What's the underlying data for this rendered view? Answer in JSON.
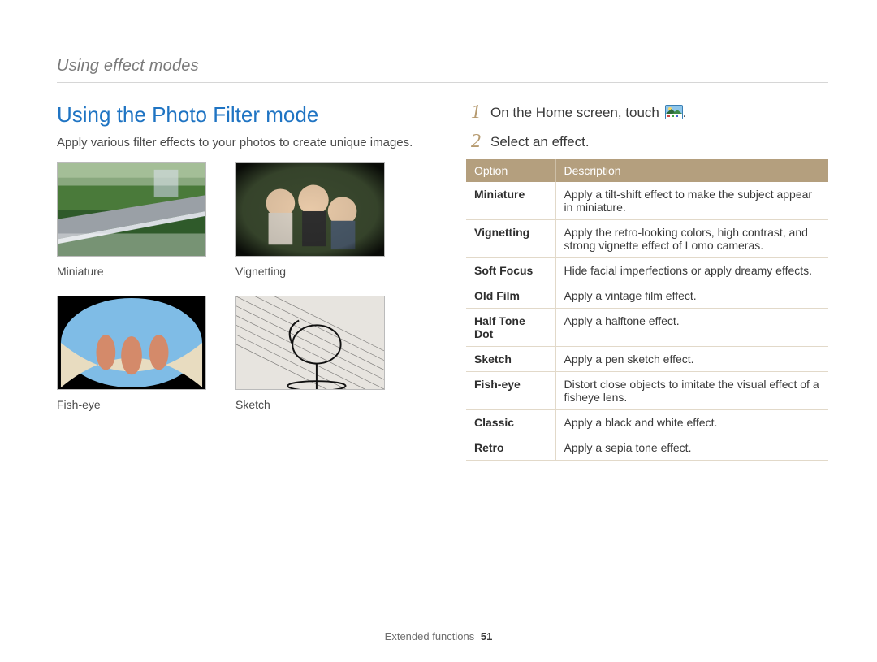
{
  "breadcrumb": "Using effect modes",
  "section_title": "Using the Photo Filter mode",
  "lead": "Apply various filter effects to your photos to create unique images.",
  "thumbs": {
    "miniature": "Miniature",
    "vignetting": "Vignetting",
    "fisheye": "Fish-eye",
    "sketch": "Sketch"
  },
  "steps": {
    "s1_num": "1",
    "s1_text_prefix": "On the Home screen, touch ",
    "s1_text_suffix": ".",
    "s2_num": "2",
    "s2_text": "Select an effect."
  },
  "table": {
    "head_option": "Option",
    "head_description": "Description",
    "rows": [
      {
        "option": "Miniature",
        "desc": "Apply a tilt-shift effect to make the subject appear in miniature."
      },
      {
        "option": "Vignetting",
        "desc": "Apply the retro-looking colors, high contrast, and strong vignette effect of Lomo cameras."
      },
      {
        "option": "Soft Focus",
        "desc": "Hide facial imperfections or apply dreamy effects."
      },
      {
        "option": "Old Film",
        "desc": "Apply a vintage film effect."
      },
      {
        "option": "Half Tone Dot",
        "desc": "Apply a halftone effect."
      },
      {
        "option": "Sketch",
        "desc": "Apply a pen sketch effect."
      },
      {
        "option": "Fish-eye",
        "desc": "Distort close objects to imitate the visual effect of a fisheye lens."
      },
      {
        "option": "Classic",
        "desc": "Apply a black and white effect."
      },
      {
        "option": "Retro",
        "desc": "Apply a sepia tone effect."
      }
    ]
  },
  "footer": {
    "label": "Extended functions",
    "page": "51"
  }
}
